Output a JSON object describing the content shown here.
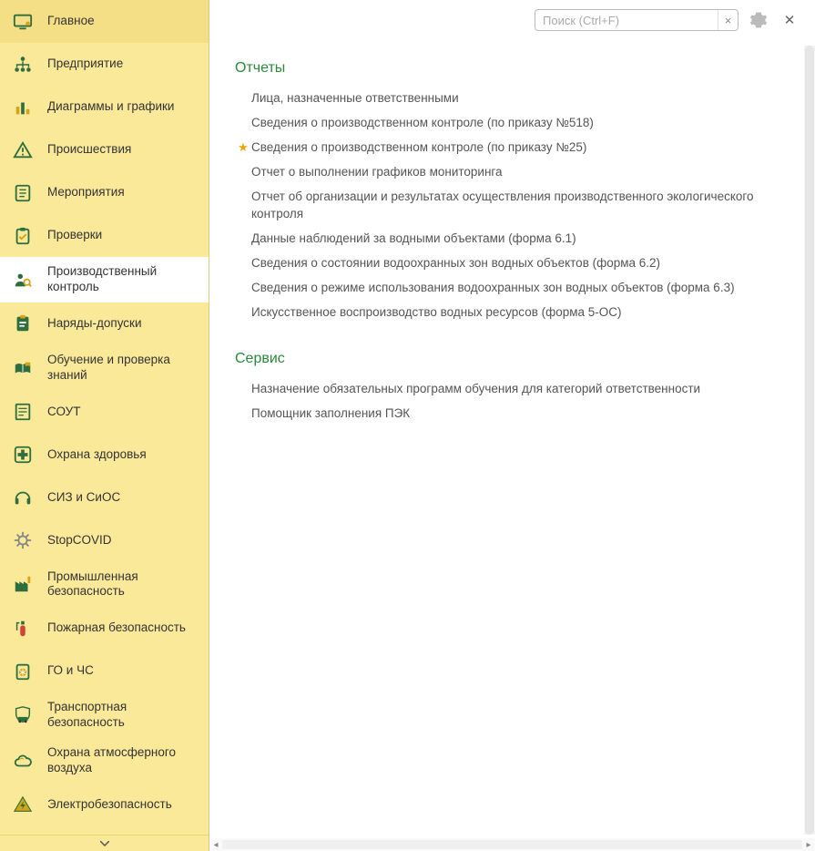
{
  "search": {
    "placeholder": "Поиск (Ctrl+F)",
    "value": ""
  },
  "sidebar": {
    "active_index": 6,
    "items": [
      {
        "label": "Главное",
        "icon": "monitor-icon"
      },
      {
        "label": "Предприятие",
        "icon": "orgchart-icon"
      },
      {
        "label": "Диаграммы и графики",
        "icon": "chart-icon"
      },
      {
        "label": "Происшествия",
        "icon": "warning-triangle-icon"
      },
      {
        "label": "Мероприятия",
        "icon": "document-list-icon"
      },
      {
        "label": "Проверки",
        "icon": "clipboard-check-icon"
      },
      {
        "label": "Производственный контроль",
        "icon": "person-search-icon"
      },
      {
        "label": "Наряды-допуски",
        "icon": "badge-icon"
      },
      {
        "label": "Обучение и проверка знаний",
        "icon": "training-icon"
      },
      {
        "label": "СОУТ",
        "icon": "form-icon"
      },
      {
        "label": "Охрана здоровья",
        "icon": "medical-cross-icon"
      },
      {
        "label": "СИЗ и СиОС",
        "icon": "headphones-icon"
      },
      {
        "label": "StopCOVID",
        "icon": "virus-icon"
      },
      {
        "label": "Промышленная безопасность",
        "icon": "factory-icon"
      },
      {
        "label": "Пожарная безопасность",
        "icon": "extinguisher-icon"
      },
      {
        "label": "ГО и ЧС",
        "icon": "civil-defence-icon"
      },
      {
        "label": "Транспортная безопасность",
        "icon": "car-shield-icon"
      },
      {
        "label": "Охрана атмосферного воздуха",
        "icon": "cloud-icon"
      },
      {
        "label": "Электробезопасность",
        "icon": "electrical-warning-icon"
      }
    ]
  },
  "sections": [
    {
      "title": "Отчеты",
      "items": [
        {
          "starred": false,
          "label": "Лица, назначенные ответственными"
        },
        {
          "starred": false,
          "label": "Сведения о производственном контроле (по приказу №518)"
        },
        {
          "starred": true,
          "label": "Сведения о производственном контроле (по приказу №25)"
        },
        {
          "starred": false,
          "label": "Отчет о выполнении графиков мониторинга"
        },
        {
          "starred": false,
          "label": "Отчет об организации и результатах осуществления производственного экологического контроля"
        },
        {
          "starred": false,
          "label": "Данные наблюдений за водными объектами (форма 6.1)"
        },
        {
          "starred": false,
          "label": "Сведения о состоянии водоохранных зон водных объектов (форма 6.2)"
        },
        {
          "starred": false,
          "label": "Сведения о режиме использования водоохранных зон водных объектов (форма 6.3)"
        },
        {
          "starred": false,
          "label": "Искусственное воспроизводство водных ресурсов (форма 5-ОС)"
        }
      ]
    },
    {
      "title": "Сервис",
      "items": [
        {
          "starred": false,
          "label": "Назначение обязательных программ обучения для категорий ответственности"
        },
        {
          "starred": false,
          "label": "Помощник заполнения ПЭК"
        }
      ]
    }
  ]
}
